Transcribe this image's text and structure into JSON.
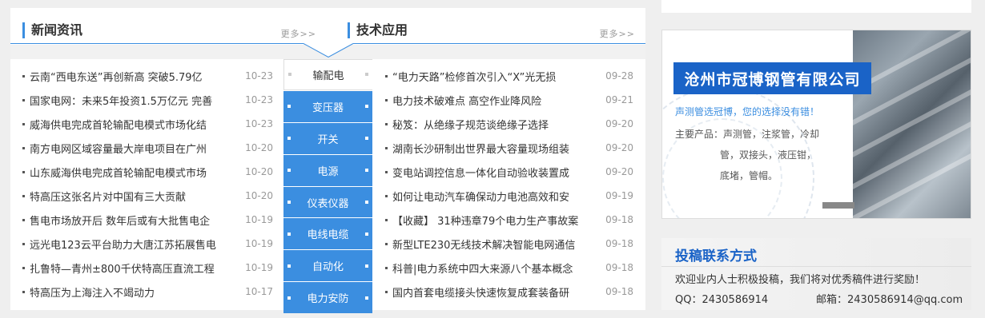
{
  "news": {
    "title": "新闻资讯",
    "more": "更多>>",
    "items": [
      {
        "text": "云南“西电东送”再创新高 突破5.79亿",
        "date": "10-23"
      },
      {
        "text": "国家电网：未来5年投资1.5万亿元 完善",
        "date": "10-23"
      },
      {
        "text": "威海供电完成首轮输配电模式市场化结",
        "date": "10-23"
      },
      {
        "text": "南方电网区域容量最大岸电项目在广州",
        "date": "10-20"
      },
      {
        "text": "山东威海供电完成首轮输配电模式市场",
        "date": "10-20"
      },
      {
        "text": "特高压这张名片对中国有三大贡献",
        "date": "10-20"
      },
      {
        "text": "售电市场放开后 数年后或有大批售电企",
        "date": "10-19"
      },
      {
        "text": "远光电123云平台助力大唐江苏拓展售电",
        "date": "10-19"
      },
      {
        "text": "扎鲁特—青州±800千伏特高压直流工程",
        "date": "10-19"
      },
      {
        "text": "特高压为上海注入不竭动力",
        "date": "10-17"
      }
    ]
  },
  "tech": {
    "title": "技术应用",
    "more": "更多>>",
    "items": [
      {
        "text": "“电力天路”检修首次引入“X”光无损",
        "date": "09-28"
      },
      {
        "text": "电力技术破难点 高空作业降风险",
        "date": "09-21"
      },
      {
        "text": "秘笈：从绝缘子规范谈绝缘子选择",
        "date": "09-20"
      },
      {
        "text": "湖南长沙研制出世界最大容量现场组装",
        "date": "09-20"
      },
      {
        "text": "变电站调控信息一体化自动验收装置成",
        "date": "09-20"
      },
      {
        "text": "如何让电动汽车确保动力电池高效和安",
        "date": "09-19"
      },
      {
        "text": "【收藏】 31种违章79个电力生产事故案",
        "date": "09-18"
      },
      {
        "text": "新型LTE230无线技术解决智能电网通信",
        "date": "09-18"
      },
      {
        "text": "科普|电力系统中四大来源八个基本概念",
        "date": "09-18"
      },
      {
        "text": "国内首套电缆接头快速恢复成套装备研",
        "date": "09-18"
      }
    ]
  },
  "categories": {
    "active_index": 0,
    "items": [
      "输配电",
      "变压器",
      "开关",
      "电源",
      "仪表仪器",
      "电线电缆",
      "自动化",
      "电力安防"
    ]
  },
  "ad": {
    "company": "沧州市冠博钢管有限公司",
    "slogan": "声测管选冠博，您的选择没有错！",
    "products_line1": "主要产品：声测管，注浆管，冷却",
    "products_line2": "管，双接头，液压钳，",
    "products_line3": "底堵，管帽。"
  },
  "contact": {
    "title": "投稿联系方式",
    "text": "欢迎业内人士积极投稿，我们将对优秀稿件进行奖励！",
    "qq": "QQ：2430586914",
    "email": "邮箱：2430586914@qq.com"
  },
  "colors": {
    "accent": "#3b8ee0",
    "ad_title_bg": "#1a63c7"
  }
}
